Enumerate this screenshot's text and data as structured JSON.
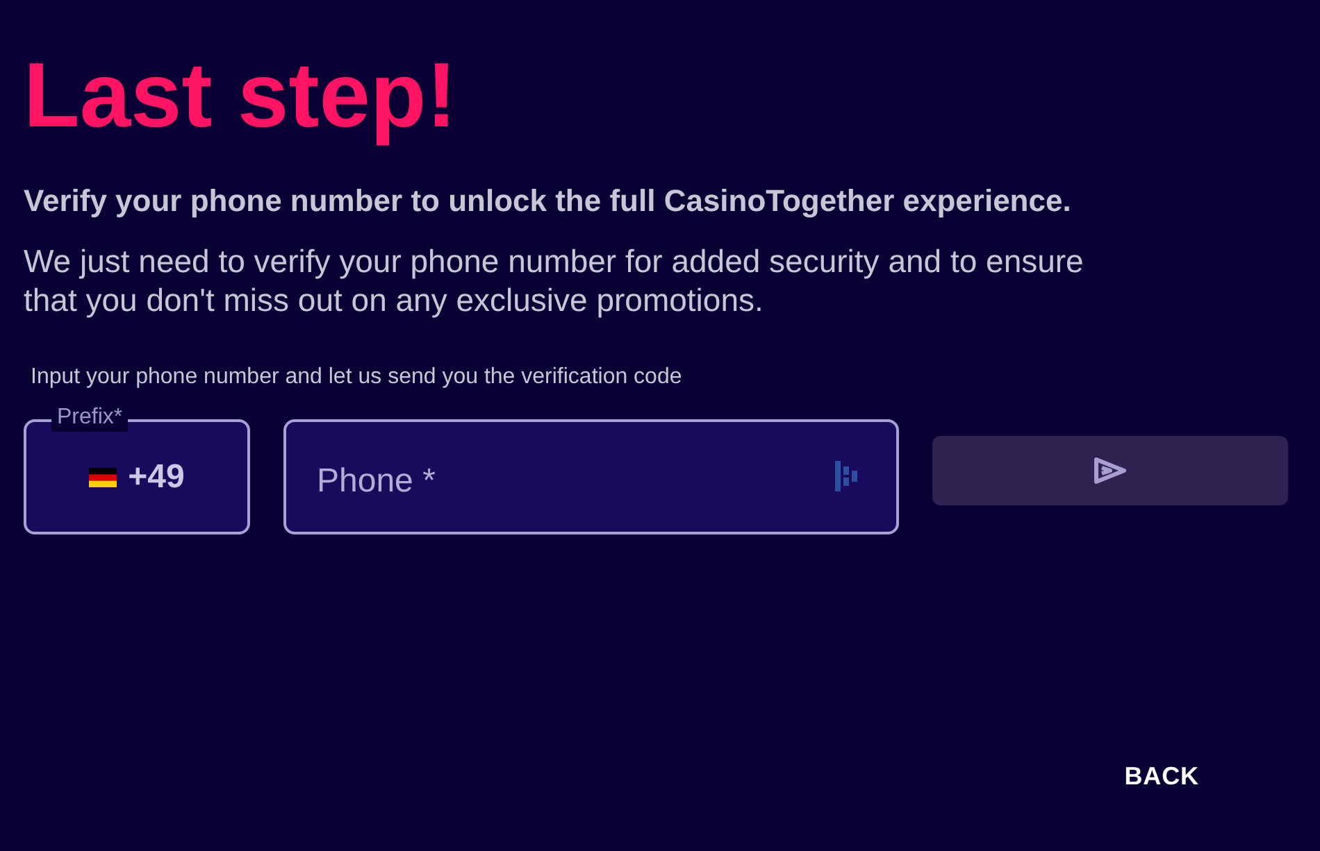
{
  "title": "Last step!",
  "subtitle": "Verify your phone number to unlock the full CasinoTogether experience.",
  "description": "We just need to verify your phone number for added security and to ensure that you don't miss out on any exclusive promotions.",
  "hint": "Input your phone number and let us send you the verification code",
  "prefix": {
    "label": "Prefix*",
    "value": "+49"
  },
  "phone": {
    "placeholder": "Phone *"
  },
  "send_button": {
    "disabled": true
  },
  "back_button": "BACK"
}
